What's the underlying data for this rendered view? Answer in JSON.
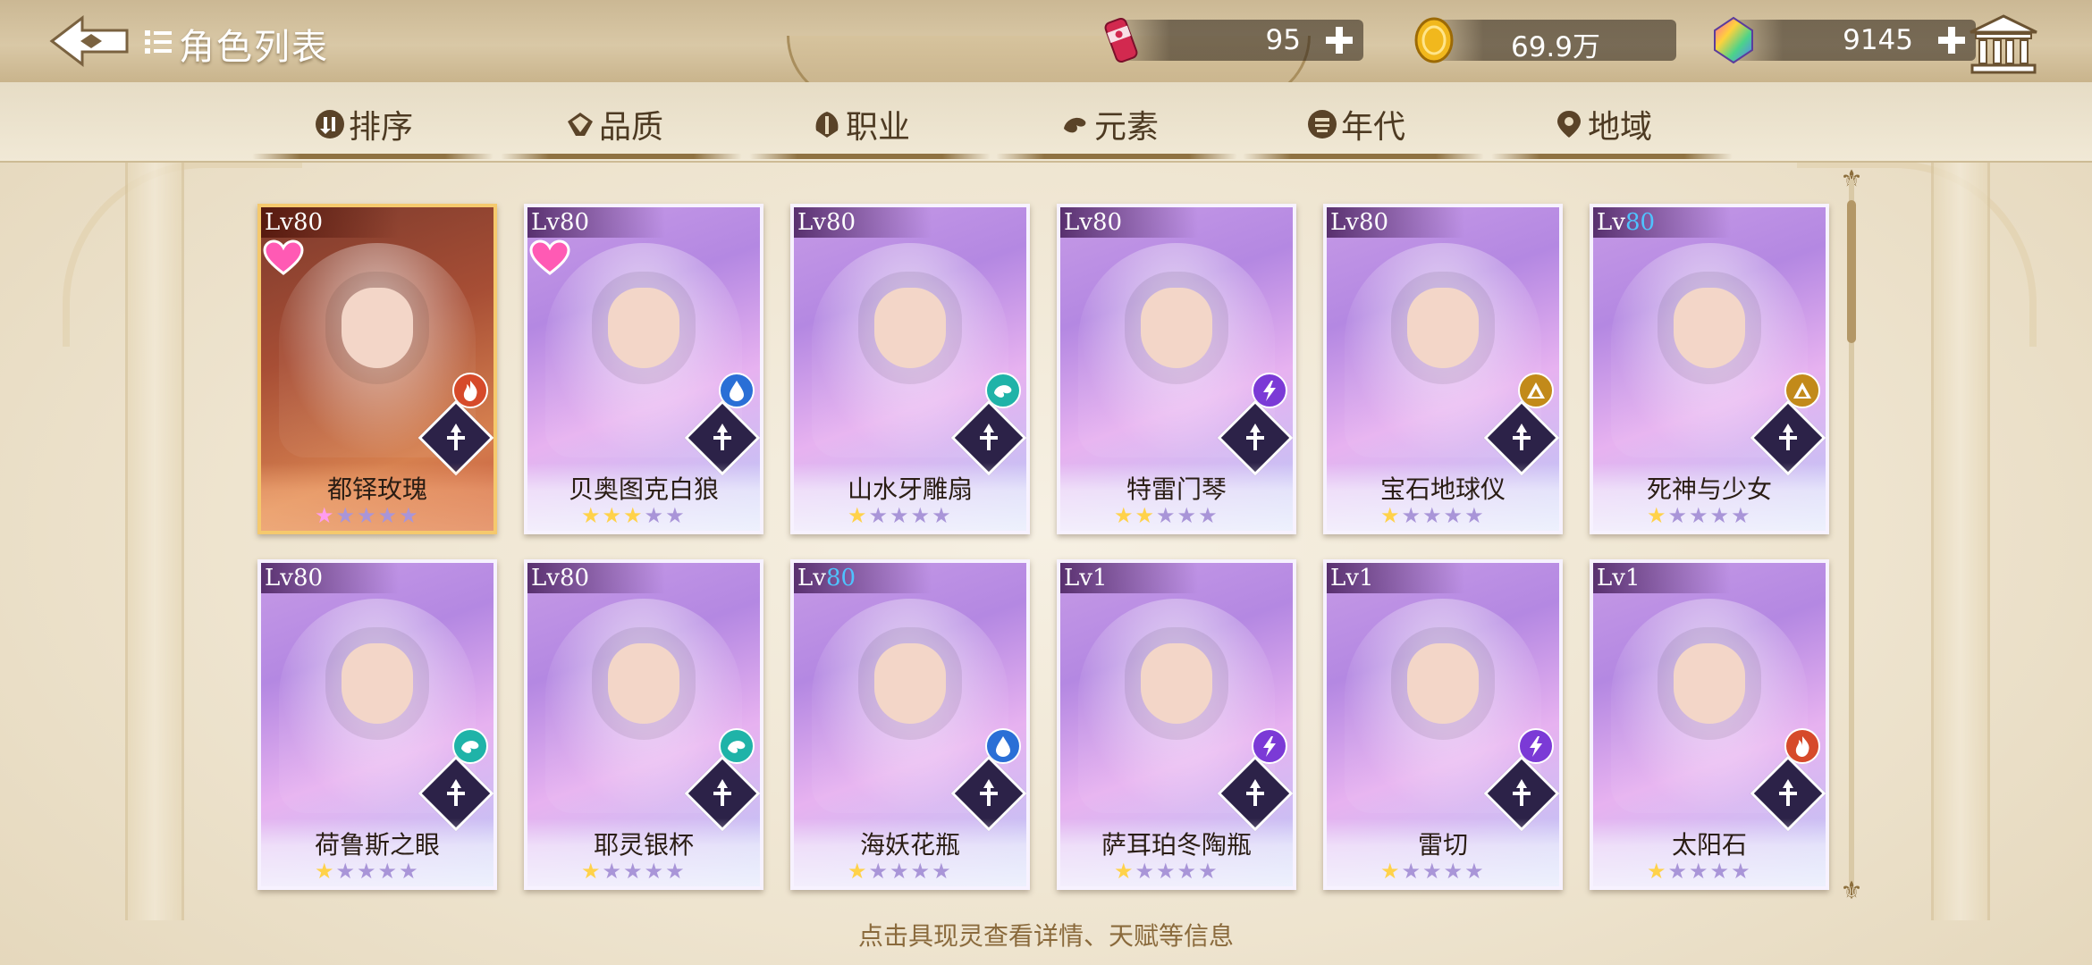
{
  "header": {
    "title": "角色列表",
    "currencies": [
      {
        "icon": "soda-can-icon",
        "value": "95"
      },
      {
        "icon": "gold-coin-icon",
        "value": "69.9万"
      },
      {
        "icon": "rainbow-gem-icon",
        "value": "9145"
      }
    ]
  },
  "tabs": [
    {
      "label": "排序",
      "icon": "sort-icon"
    },
    {
      "label": "品质",
      "icon": "quality-diamond-icon"
    },
    {
      "label": "职业",
      "icon": "class-emblem-icon"
    },
    {
      "label": "元素",
      "icon": "element-swirl-icon"
    },
    {
      "label": "年代",
      "icon": "era-icon"
    },
    {
      "label": "地域",
      "icon": "location-pin-icon"
    }
  ],
  "cards": [
    {
      "lv_prefix": "Lv",
      "lv": "80",
      "name": "都铎玫瑰",
      "stars": 1,
      "theme": "red",
      "heart": true,
      "element": "fire",
      "element_color": "#d64a2a"
    },
    {
      "lv_prefix": "Lv",
      "lv": "80",
      "name": "贝奥图克白狼",
      "stars": 3,
      "theme": "purple",
      "heart": true,
      "element": "water",
      "element_color": "#2a6fd6"
    },
    {
      "lv_prefix": "Lv",
      "lv": "80",
      "name": "山水牙雕扇",
      "stars": 1,
      "theme": "purple",
      "heart": false,
      "element": "wind",
      "element_color": "#1fb3a8"
    },
    {
      "lv_prefix": "Lv",
      "lv": "80",
      "name": "特雷门琴",
      "stars": 2,
      "theme": "purple",
      "heart": false,
      "element": "thunder",
      "element_color": "#7b3ad6"
    },
    {
      "lv_prefix": "Lv",
      "lv": "80",
      "name": "宝石地球仪",
      "stars": 1,
      "theme": "purple",
      "heart": false,
      "element": "earth",
      "element_color": "#c28a1a"
    },
    {
      "lv_prefix": "Lv",
      "lv": "80",
      "name": "死神与少女",
      "stars": 1,
      "theme": "purple",
      "heart": false,
      "element": "earth",
      "element_color": "#c28a1a"
    },
    {
      "lv_prefix": "Lv",
      "lv": "80",
      "name": "荷鲁斯之眼",
      "stars": 1,
      "theme": "purple",
      "heart": false,
      "element": "wind",
      "element_color": "#1fb3a8"
    },
    {
      "lv_prefix": "Lv",
      "lv": "80",
      "name": "耶灵银杯",
      "stars": 1,
      "theme": "purple",
      "heart": false,
      "element": "wind",
      "element_color": "#1fb3a8"
    },
    {
      "lv_prefix": "Lv",
      "lv": "80",
      "name": "海妖花瓶",
      "stars": 1,
      "theme": "purple",
      "heart": false,
      "element": "water",
      "element_color": "#2a6fd6"
    },
    {
      "lv_prefix": "Lv",
      "lv": "1",
      "name": "萨耳珀冬陶瓶",
      "stars": 1,
      "theme": "purple",
      "heart": false,
      "element": "thunder",
      "element_color": "#7b3ad6"
    },
    {
      "lv_prefix": "Lv",
      "lv": "1",
      "name": "雷切",
      "stars": 1,
      "theme": "purple",
      "heart": false,
      "element": "thunder",
      "element_color": "#7b3ad6"
    },
    {
      "lv_prefix": "Lv",
      "lv": "1",
      "name": "太阳石",
      "stars": 1,
      "theme": "purple",
      "heart": false,
      "element": "fire",
      "element_color": "#d64a2a"
    }
  ],
  "footer": {
    "hint": "点击具现灵查看详情、天赋等信息"
  }
}
